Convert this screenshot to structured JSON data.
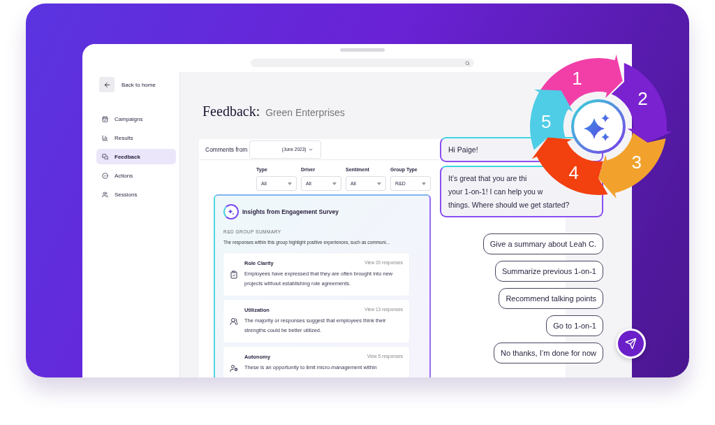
{
  "sidebar": {
    "back": {
      "label": "Back to home"
    },
    "items": [
      {
        "label": "Campaigns",
        "selected": false
      },
      {
        "label": "Results",
        "selected": false
      },
      {
        "label": "Feedback",
        "selected": true
      },
      {
        "label": "Actions",
        "selected": false
      },
      {
        "label": "Sessions",
        "selected": false
      }
    ]
  },
  "header": {
    "title": "Feedback:",
    "subtitle": "Green Enterprises"
  },
  "comments": {
    "label": "Comments from",
    "period": "(June 2023)"
  },
  "filters": [
    {
      "label": "Type",
      "value": "All"
    },
    {
      "label": "Driver",
      "value": "All"
    },
    {
      "label": "Sentiment",
      "value": "All"
    },
    {
      "label": "Group Type",
      "value": "R&D"
    }
  ],
  "insights": {
    "title": "Insights from Engagement Survey",
    "section": "R&D GROUP SUMMARY",
    "summary": "The responses within this group highlight positive experiences, such as communi...",
    "cards": [
      {
        "title": "Role Clarity",
        "link": "View 20 responses",
        "text": "Employees have expressed that they are often brought into new projects without establishing role agreements."
      },
      {
        "title": "Utilization",
        "link": "View 13 responses",
        "text": "The majority or responses suggest that employees think their strengths could be better utilized."
      },
      {
        "title": "Autonomy",
        "link": "View 5 responses",
        "text": "These is an opportunity to limit micro-management within"
      }
    ]
  },
  "chat": {
    "greeting": "Hi Paige!",
    "message_lines": [
      "It’s great that you are thi",
      "your 1-on-1! I can help you w",
      "things. Where should we get started?"
    ],
    "options": [
      "Give a summary about Leah C.",
      "Summarize previous 1-on-1",
      "Recommend talking points",
      "Go to 1-on-1",
      "No thanks, I’m done for now"
    ]
  },
  "wheel": {
    "steps": [
      {
        "label": "1",
        "color": "#f23fa8"
      },
      {
        "label": "2",
        "color": "#7b22d0"
      },
      {
        "label": "3",
        "color": "#f2a22c"
      },
      {
        "label": "4",
        "color": "#f2400f"
      },
      {
        "label": "5",
        "color": "#4fcde6"
      }
    ]
  }
}
